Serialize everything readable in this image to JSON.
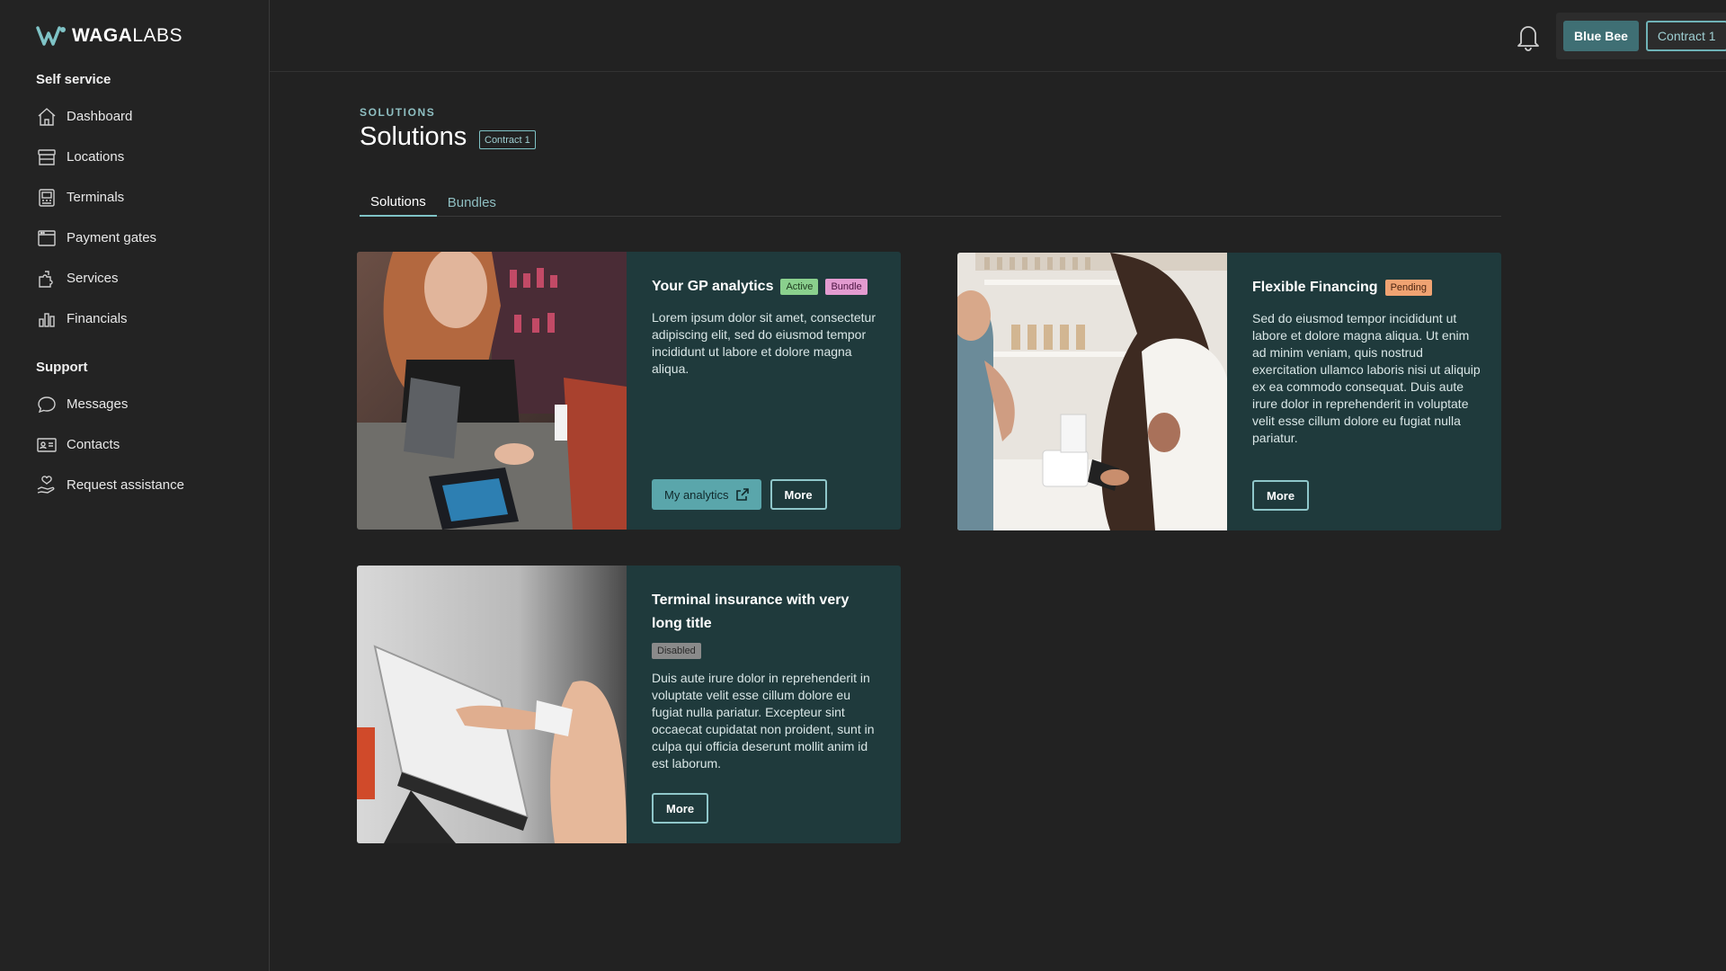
{
  "brand": {
    "name_bold": "WAGA",
    "name_light": "LABS"
  },
  "sidebar": {
    "self_service_title": "Self service",
    "self_service_items": [
      {
        "label": "Dashboard",
        "icon": "home-icon"
      },
      {
        "label": "Locations",
        "icon": "store-icon"
      },
      {
        "label": "Terminals",
        "icon": "terminal-icon"
      },
      {
        "label": "Payment gates",
        "icon": "window-icon"
      },
      {
        "label": "Services",
        "icon": "puzzle-icon"
      },
      {
        "label": "Financials",
        "icon": "bar-chart-icon"
      }
    ],
    "support_title": "Support",
    "support_items": [
      {
        "label": "Messages",
        "icon": "chat-icon"
      },
      {
        "label": "Contacts",
        "icon": "contact-card-icon"
      },
      {
        "label": "Request assistance",
        "icon": "hand-heart-icon"
      }
    ]
  },
  "header": {
    "org_label": "Blue Bee",
    "contract_label": "Contract 1"
  },
  "page": {
    "eyebrow": "SOLUTIONS",
    "title": "Solutions",
    "contract_badge": "Contract 1",
    "tabs": [
      {
        "label": "Solutions",
        "active": true
      },
      {
        "label": "Bundles",
        "active": false
      }
    ]
  },
  "cards": [
    {
      "title": "Your GP analytics",
      "badges": [
        "Active",
        "Bundle"
      ],
      "description": "Lorem ipsum dolor sit amet, consectetur adipiscing elit, sed do eiusmod  tempor incididunt ut labore et dolore magna aliqua.",
      "primary_button": "My analytics",
      "more_button": "More"
    },
    {
      "title": "Flexible Financing",
      "badges": [
        "Pending"
      ],
      "description": "Sed do eiusmod  tempor incididunt ut labore et dolore magna aliqua. Ut enim ad minim  veniam, quis nostrud exercitation ullamco laboris nisi ut aliquip ex ea  commodo consequat. Duis aute irure dolor in reprehenderit in voluptate  velit esse cillum dolore eu fugiat nulla pariatur.",
      "more_button": "More"
    },
    {
      "title": "Terminal insurance with very long title",
      "badges": [
        "Disabled"
      ],
      "description": "Duis aute irure dolor in reprehenderit in voluptate  velit esse cillum dolore eu fugiat nulla pariatur. Excepteur sint occaecat cupidatat non proident, sunt in culpa qui officia deserunt  mollit anim id est laborum.",
      "more_button": "More"
    }
  ],
  "colors": {
    "background": "#222222",
    "card": "#1f3a3c",
    "accent": "#7fc3c6",
    "active_badge": "#8ad08d",
    "bundle_badge": "#e39bd0",
    "pending_badge": "#f0a372",
    "disabled_badge": "#8a8a8a"
  }
}
